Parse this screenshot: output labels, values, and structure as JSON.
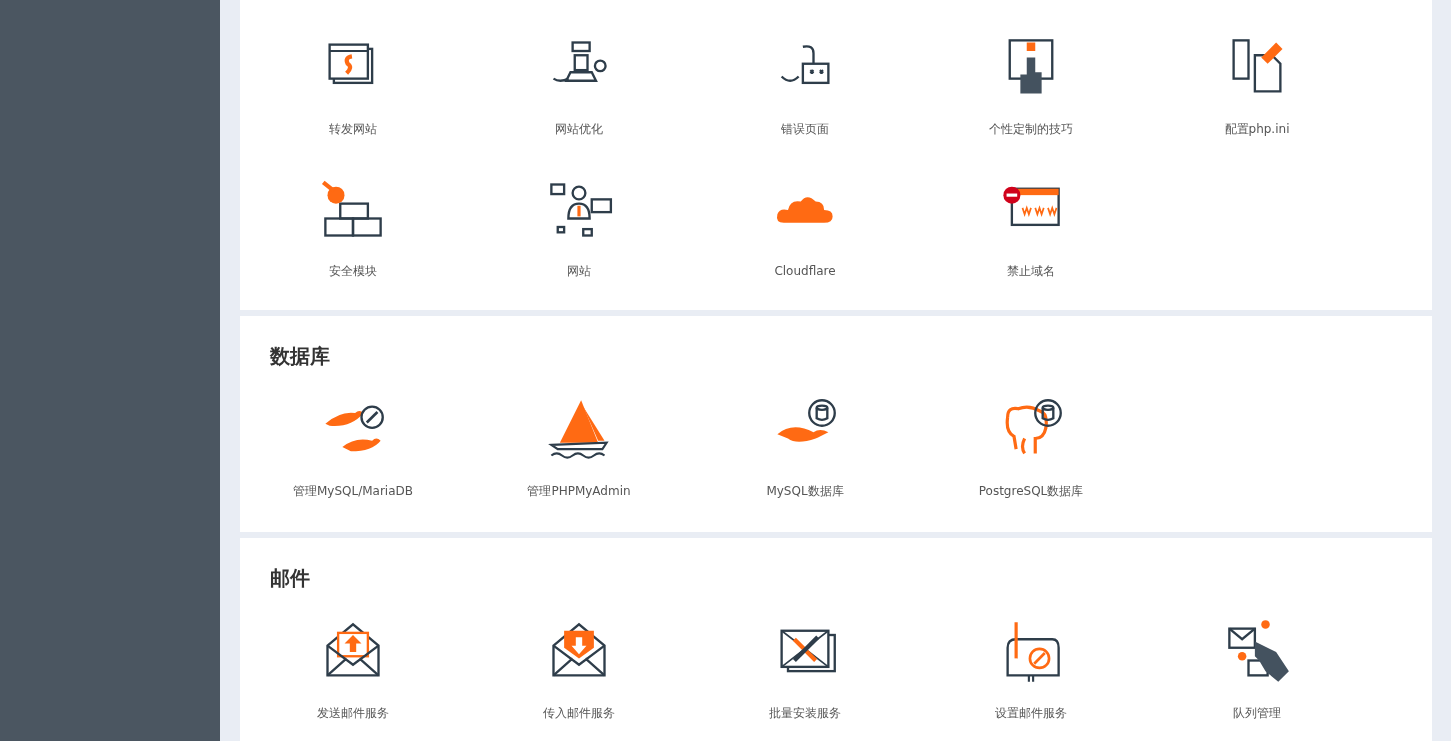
{
  "sections": [
    {
      "items": [
        {
          "label": "转发网站"
        },
        {
          "label": "网站优化"
        },
        {
          "label": "错误页面"
        },
        {
          "label": "个性定制的技巧"
        },
        {
          "label": "配置php.ini"
        },
        {
          "label": "安全模块"
        },
        {
          "label": "网站"
        },
        {
          "label": "Cloudflare"
        },
        {
          "label": "禁止域名"
        }
      ]
    },
    {
      "title": "数据库",
      "items": [
        {
          "label": "管理MySQL/MariaDB"
        },
        {
          "label": "管理PHPMyAdmin"
        },
        {
          "label": "MySQL数据库"
        },
        {
          "label": "PostgreSQL数据库"
        }
      ]
    },
    {
      "title": "邮件",
      "items": [
        {
          "label": "发送邮件服务"
        },
        {
          "label": "传入邮件服务"
        },
        {
          "label": "批量安装服务"
        },
        {
          "label": "设置邮件服务"
        },
        {
          "label": "队列管理"
        }
      ]
    }
  ]
}
